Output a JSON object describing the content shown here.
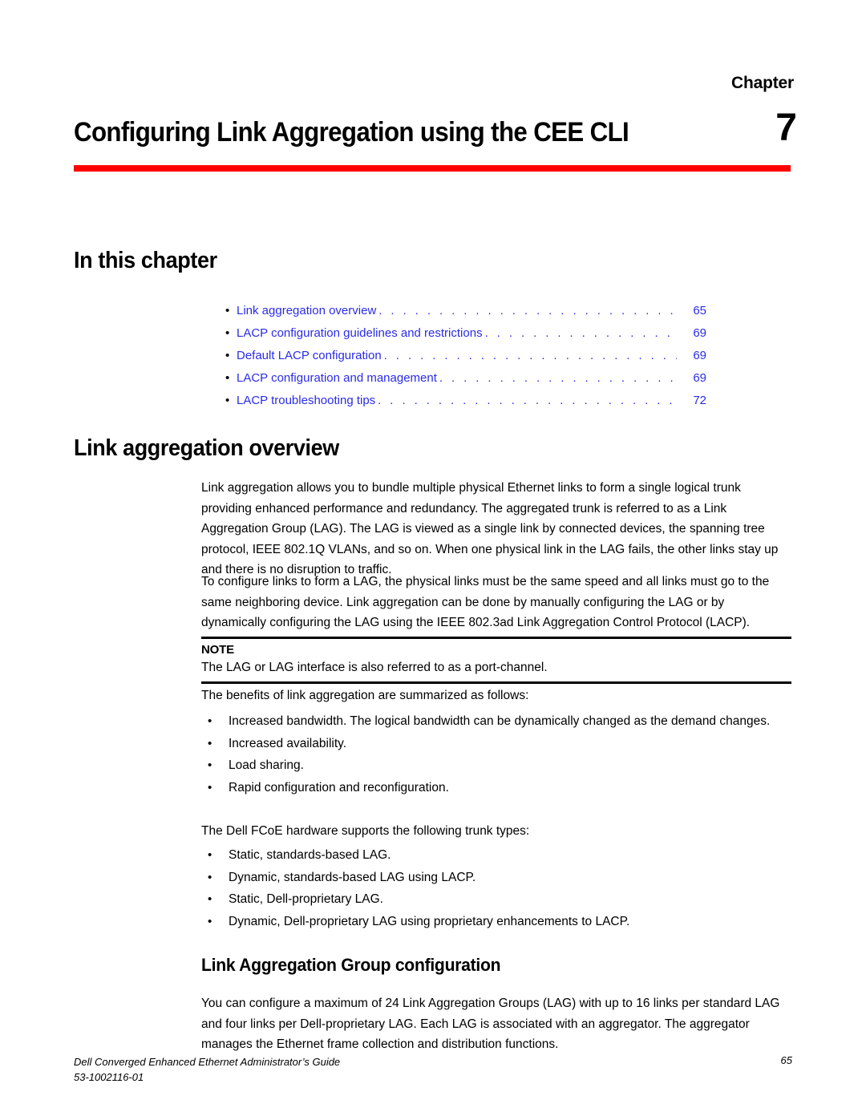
{
  "header": {
    "chapter_label": "Chapter",
    "chapter_number": "7",
    "chapter_title": "Configuring Link Aggregation using the CEE CLI",
    "rule_color": "#ff0000"
  },
  "in_this_chapter": {
    "heading": "In this chapter",
    "link_color": "#2b2be8",
    "entries": [
      {
        "label": "Link aggregation overview",
        "page": "65"
      },
      {
        "label": "LACP configuration guidelines and restrictions",
        "page": "69"
      },
      {
        "label": "Default LACP configuration",
        "page": "69"
      },
      {
        "label": "LACP configuration and management",
        "page": "69"
      },
      {
        "label": "LACP troubleshooting tips",
        "page": "72"
      }
    ]
  },
  "sections": {
    "link_aggregation_overview": {
      "heading": "Link aggregation overview",
      "paragraph_1": "Link aggregation allows you to bundle multiple physical Ethernet links to form a single logical trunk providing enhanced performance and redundancy. The aggregated trunk is referred to as a Link Aggregation Group (LAG). The LAG is viewed as a single link by connected devices, the spanning tree protocol, IEEE 802.1Q VLANs, and so on. When one physical link in the LAG fails, the other links stay up and there is no disruption to traffic.",
      "paragraph_2": "To configure links to form a LAG, the physical links must be the same speed and all links must go to the same neighboring device. Link aggregation can be done by manually configuring the LAG or by dynamically configuring the LAG using the IEEE 802.3ad Link Aggregation Control Protocol (LACP).",
      "note": {
        "title": "NOTE",
        "text": "The LAG or LAG interface is also referred to as a port-channel."
      },
      "benefits_intro": "The benefits of link aggregation are summarized as follows:",
      "benefits": [
        "Increased bandwidth. The logical bandwidth can be dynamically changed as the demand changes.",
        "Increased availability.",
        "Load sharing.",
        "Rapid configuration and reconfiguration."
      ],
      "trunk_types_intro": "The Dell FCoE hardware supports the following trunk types:",
      "trunk_types": [
        "Static, standards-based LAG.",
        "Dynamic, standards-based LAG using LACP.",
        "Static, Dell-proprietary LAG.",
        "Dynamic, Dell-proprietary LAG using proprietary enhancements to LACP."
      ]
    },
    "lag_configuration": {
      "heading": "Link Aggregation Group configuration",
      "paragraph_1": "You can configure a maximum of 24 Link Aggregation Groups (LAG) with up to 16 links per standard LAG and four links per Dell-proprietary LAG. Each LAG is associated with an aggregator. The aggregator manages the Ethernet frame collection and distribution functions."
    }
  },
  "footer": {
    "guide_title": "Dell Converged Enhanced Ethernet Administrator’s Guide",
    "document_number": "53-1002116-01",
    "page_number": "65"
  },
  "glyphs": {
    "bullet": "•",
    "leader_dots": ". . . . . . . . . . . . . . . . . . . . . . . . . . . . . . . . . . . . . . . . . . . . . . . . . . . . . . . . . . . . . . . ."
  }
}
